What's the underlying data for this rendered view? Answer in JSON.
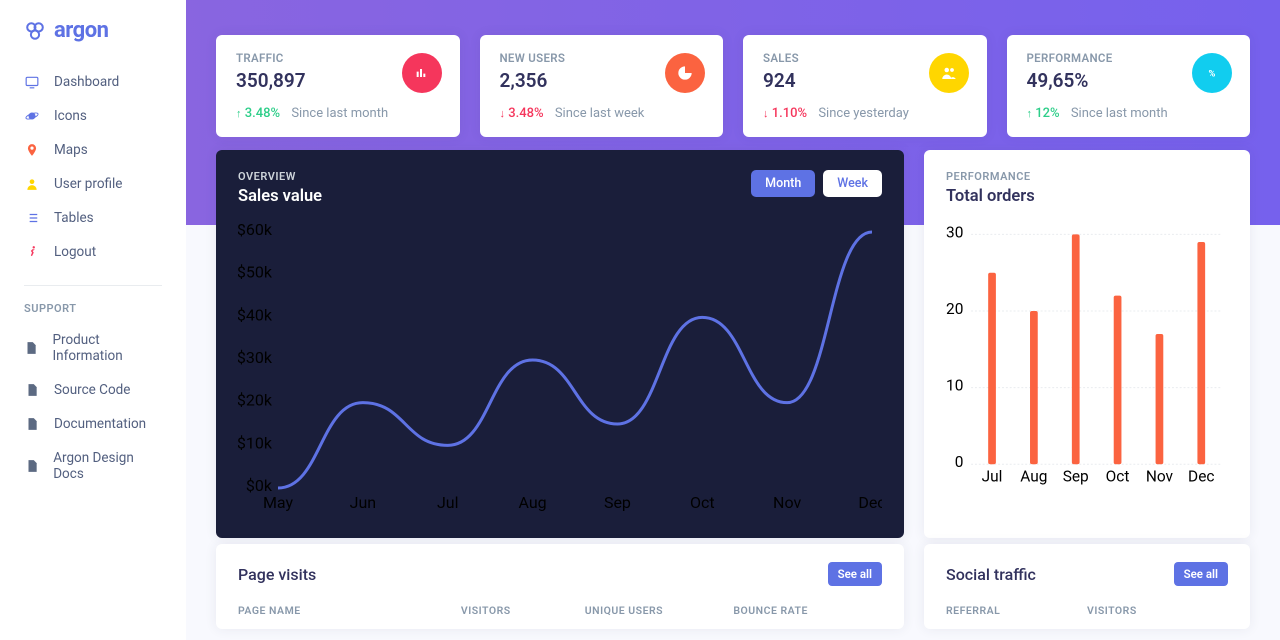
{
  "brand": "argon",
  "sidebar": {
    "items": [
      {
        "label": "Dashboard",
        "color": "#5e72e4",
        "icon": "tv"
      },
      {
        "label": "Icons",
        "color": "#5e72e4",
        "icon": "planet"
      },
      {
        "label": "Maps",
        "color": "#fb6340",
        "icon": "pin"
      },
      {
        "label": "User profile",
        "color": "#ffd600",
        "icon": "user"
      },
      {
        "label": "Tables",
        "color": "#5e72e4",
        "icon": "list"
      },
      {
        "label": "Logout",
        "color": "#f5365c",
        "icon": "run"
      }
    ],
    "support_label": "SUPPORT",
    "support": [
      {
        "label": "Product Information"
      },
      {
        "label": "Source Code"
      },
      {
        "label": "Documentation"
      },
      {
        "label": "Argon Design Docs"
      }
    ]
  },
  "stats": [
    {
      "title": "TRAFFIC",
      "value": "350,897",
      "delta": "3.48%",
      "dir": "up",
      "since": "Since last month"
    },
    {
      "title": "NEW USERS",
      "value": "2,356",
      "delta": "3.48%",
      "dir": "down",
      "since": "Since last week"
    },
    {
      "title": "SALES",
      "value": "924",
      "delta": "1.10%",
      "dir": "down",
      "since": "Since yesterday"
    },
    {
      "title": "PERFORMANCE",
      "value": "49,65%",
      "delta": "12%",
      "dir": "up",
      "since": "Since last month"
    }
  ],
  "overview": {
    "overline": "OVERVIEW",
    "title": "Sales value",
    "tabs": {
      "month": "Month",
      "week": "Week"
    }
  },
  "performance": {
    "overline": "PERFORMANCE",
    "title": "Total orders"
  },
  "tables": {
    "visits": {
      "title": "Page visits",
      "see_all": "See all",
      "cols": [
        "PAGE NAME",
        "VISITORS",
        "UNIQUE USERS",
        "BOUNCE RATE"
      ]
    },
    "social": {
      "title": "Social traffic",
      "see_all": "See all",
      "cols": [
        "REFERRAL",
        "VISITORS"
      ]
    }
  },
  "chart_data": [
    {
      "type": "line",
      "title": "Sales value",
      "ylabel": "$k",
      "ylim": [
        0,
        60
      ],
      "y_ticks": [
        "$0k",
        "$10k",
        "$20k",
        "$30k",
        "$40k",
        "$50k",
        "$60k"
      ],
      "categories": [
        "May",
        "Jun",
        "Jul",
        "Aug",
        "Sep",
        "Oct",
        "Nov",
        "Dec"
      ],
      "values": [
        0,
        20,
        10,
        30,
        15,
        40,
        20,
        60
      ]
    },
    {
      "type": "bar",
      "title": "Total orders",
      "ylim": [
        0,
        30
      ],
      "y_ticks": [
        0,
        10,
        20,
        30
      ],
      "categories": [
        "Jul",
        "Aug",
        "Sep",
        "Oct",
        "Nov",
        "Dec"
      ],
      "values": [
        25,
        20,
        30,
        22,
        17,
        29
      ]
    }
  ]
}
